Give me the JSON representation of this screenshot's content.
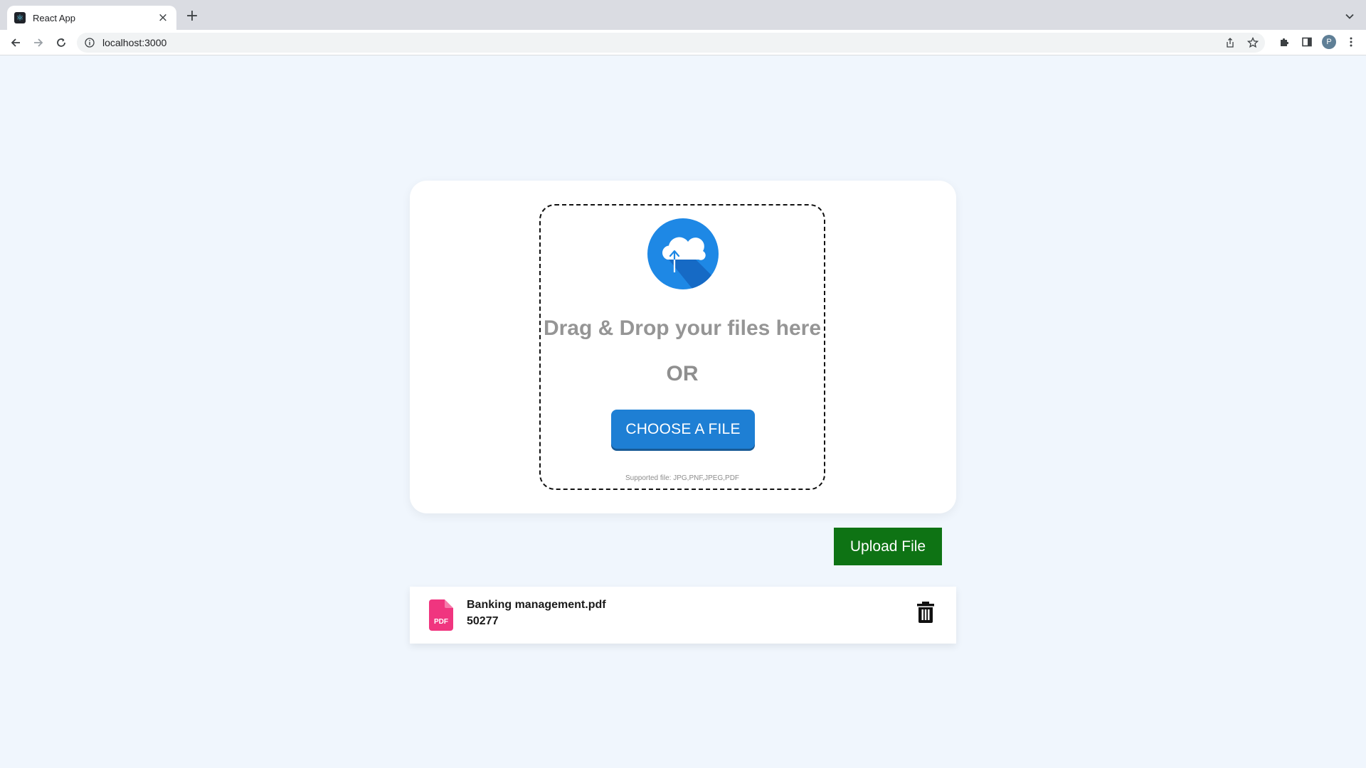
{
  "browser": {
    "tab": {
      "title": "React App",
      "close_glyph": "×",
      "favicon_icon": "react-favicon"
    },
    "new_tab_glyph": "+",
    "address": {
      "url": "localhost:3000"
    },
    "profile_initial": "P"
  },
  "uploader": {
    "icon": "cloud-upload-icon",
    "drag_text": "Drag & Drop your files here",
    "or_text": "OR",
    "choose_label": "CHOOSE A FILE",
    "supported_text": "Supported file: JPG,PNF,JPEG,PDF",
    "accent_color": "#1e7fd4"
  },
  "upload_button": {
    "label": "Upload File",
    "color": "#0e7314"
  },
  "files": [
    {
      "name": "Banking management.pdf",
      "size": "50277",
      "type_badge": "PDF",
      "badge_color": "#f0357f"
    }
  ]
}
